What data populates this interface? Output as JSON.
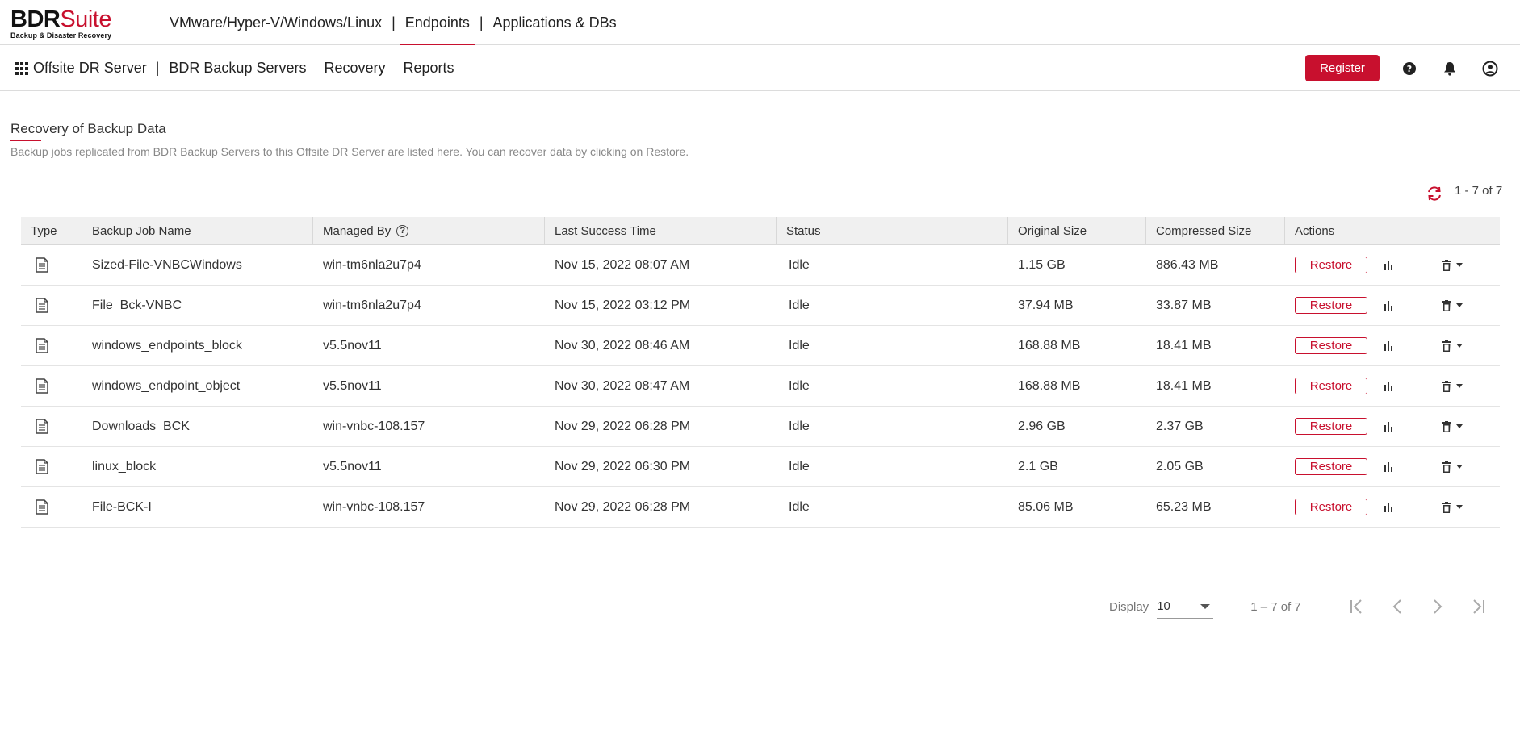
{
  "brand": {
    "name_main": "BDR",
    "name_suite": "Suite",
    "tagline": "Backup & Disaster Recovery",
    "accent": "#c8102e"
  },
  "topnav": {
    "items": [
      {
        "label": "VMware/Hyper-V/Windows/Linux",
        "active": false
      },
      {
        "label": "Endpoints",
        "active": true
      },
      {
        "label": "Applications & DBs",
        "active": false
      }
    ],
    "separator": "|"
  },
  "subnav": {
    "home_label": "Offsite DR Server",
    "separator": "|",
    "items": [
      "BDR Backup Servers",
      "Recovery",
      "Reports"
    ]
  },
  "header_right": {
    "register_label": "Register",
    "icons": [
      "help-icon",
      "bell-icon",
      "user-icon"
    ]
  },
  "page": {
    "title": "Recovery of Backup Data",
    "description": "Backup jobs replicated from BDR Backup Servers to this Offsite DR Server are listed here. You can recover data by clicking on Restore.",
    "range_top": "1 - 7 of 7"
  },
  "table": {
    "columns": [
      "Type",
      "Backup Job Name",
      "Managed By",
      "Last Success Time",
      "Status",
      "Original Size",
      "Compressed Size",
      "Actions"
    ],
    "rows": [
      {
        "name": "Sized-File-VNBCWindows",
        "managed": "win-tm6nla2u7p4",
        "last": "Nov 15, 2022 08:07 AM",
        "status": "Idle",
        "orig": "1.15 GB",
        "comp": "886.43 MB"
      },
      {
        "name": "File_Bck-VNBC",
        "managed": "win-tm6nla2u7p4",
        "last": "Nov 15, 2022 03:12 PM",
        "status": "Idle",
        "orig": "37.94 MB",
        "comp": "33.87 MB"
      },
      {
        "name": "windows_endpoints_block",
        "managed": "v5.5nov11",
        "last": "Nov 30, 2022 08:46 AM",
        "status": "Idle",
        "orig": "168.88 MB",
        "comp": "18.41 MB"
      },
      {
        "name": "windows_endpoint_object",
        "managed": "v5.5nov11",
        "last": "Nov 30, 2022 08:47 AM",
        "status": "Idle",
        "orig": "168.88 MB",
        "comp": "18.41 MB"
      },
      {
        "name": "Downloads_BCK",
        "managed": "win-vnbc-108.157",
        "last": "Nov 29, 2022 06:28 PM",
        "status": "Idle",
        "orig": "2.96 GB",
        "comp": "2.37 GB"
      },
      {
        "name": "linux_block",
        "managed": "v5.5nov11",
        "last": "Nov 29, 2022 06:30 PM",
        "status": "Idle",
        "orig": "2.1 GB",
        "comp": "2.05 GB"
      },
      {
        "name": "File-BCK-I",
        "managed": "win-vnbc-108.157",
        "last": "Nov 29, 2022 06:28 PM",
        "status": "Idle",
        "orig": "85.06 MB",
        "comp": "65.23 MB"
      }
    ],
    "restore_label": "Restore"
  },
  "pagination": {
    "display_label": "Display",
    "page_size": "10",
    "range": "1 – 7 of 7"
  }
}
